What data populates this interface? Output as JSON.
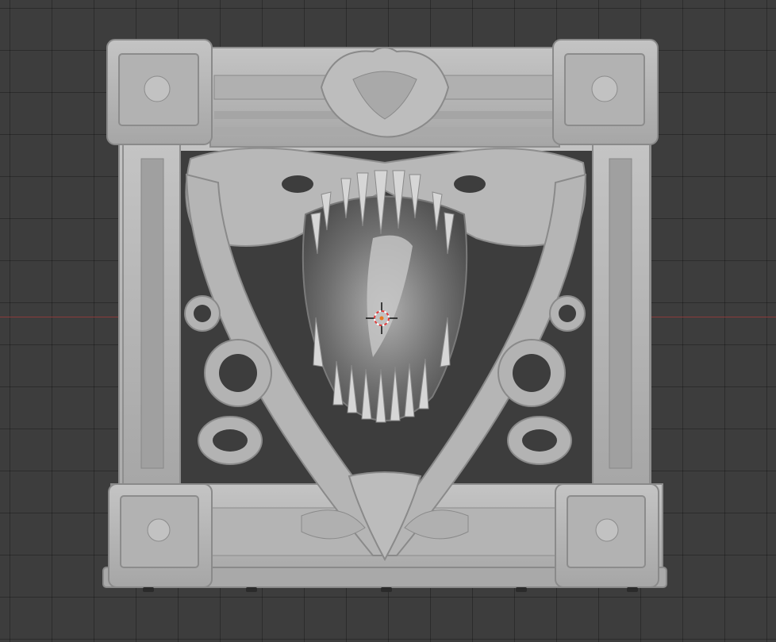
{
  "viewport": {
    "background_color": "#3d3d3d",
    "grid_color": "#2e2e2e",
    "x_axis_color": "#8a3b3b",
    "model_color": "#b3b3b3"
  },
  "scene": {
    "object": "mimic-door-frame-sculpt",
    "cursor": "3d-cursor-icon"
  }
}
